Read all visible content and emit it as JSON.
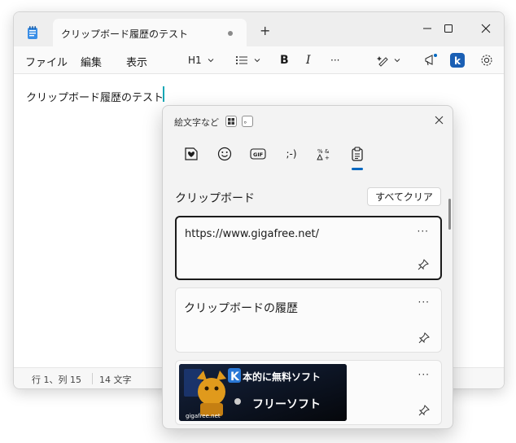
{
  "notepad": {
    "tab_title": "クリップボード履歴のテスト",
    "new_tab": "+",
    "menu": [
      "ファイル",
      "編集",
      "表示"
    ],
    "toolbar": {
      "heading": "H1",
      "bold": "B",
      "italic": "I",
      "more": "···"
    },
    "editor_text": "クリップボード履歴のテスト",
    "status": {
      "position": "行 1、列 15",
      "char_count": "14 文字"
    }
  },
  "panel": {
    "title": "絵文字など",
    "key_hint_1": "⊞",
    "key_hint_2": "。",
    "tabs": [
      {
        "icon": "heart-sticker-icon"
      },
      {
        "icon": "smiley-icon"
      },
      {
        "icon": "gif-icon",
        "label": "GIF"
      },
      {
        "icon": "kaomoji-icon",
        "label": ";-)"
      },
      {
        "icon": "symbols-icon"
      },
      {
        "icon": "clipboard-icon"
      }
    ],
    "active_tab": "clipboard",
    "section_title": "クリップボード",
    "clear_all": "すべてクリア",
    "items": [
      {
        "text": "https://www.gigafree.net/",
        "more": "···"
      },
      {
        "text": "クリップボードの履歴",
        "more": "···"
      },
      {
        "image_text_1": "本的に無料ソフト",
        "image_text_2": "フリーソフト",
        "image_badge": "gigafree.net",
        "more": "···"
      }
    ]
  },
  "colors": {
    "accent": "#0067c0",
    "caret": "#17a8b6"
  }
}
